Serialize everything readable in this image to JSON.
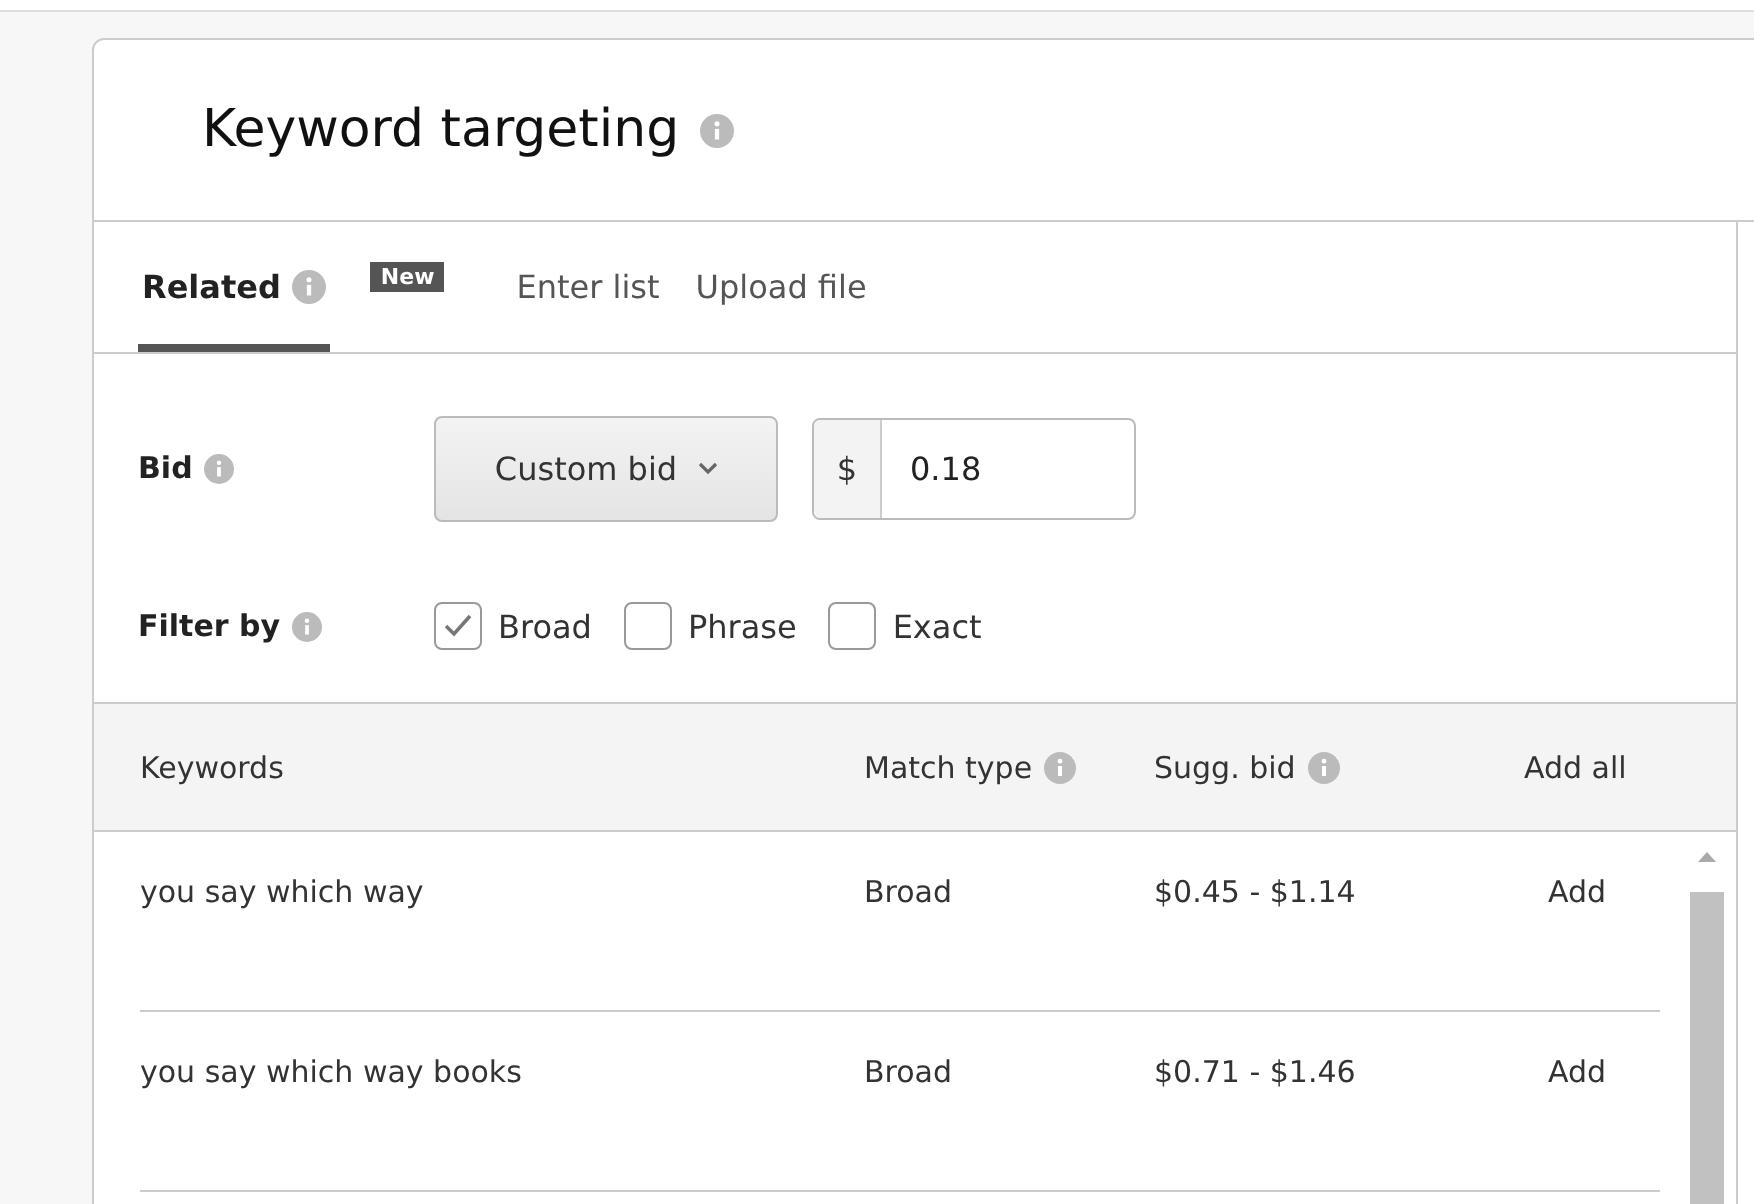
{
  "title": "Keyword targeting",
  "tabs": [
    {
      "label": "Related",
      "selected": true,
      "info": true,
      "badge": "New"
    },
    {
      "label": "Enter list",
      "selected": false
    },
    {
      "label": "Upload file",
      "selected": false
    }
  ],
  "bid": {
    "label": "Bid",
    "dropdown": "Custom bid",
    "currency": "$",
    "value": "0.18"
  },
  "filter": {
    "label": "Filter by",
    "options": [
      {
        "label": "Broad",
        "checked": true
      },
      {
        "label": "Phrase",
        "checked": false
      },
      {
        "label": "Exact",
        "checked": false
      }
    ]
  },
  "table": {
    "columns": [
      {
        "label": "Keywords",
        "info": false
      },
      {
        "label": "Match type",
        "info": true
      },
      {
        "label": "Sugg. bid",
        "info": true
      }
    ],
    "add_all": "Add all",
    "rows": [
      {
        "keyword": "you say which way",
        "match_type": "Broad",
        "sugg_bid": "$0.45 - $1.14",
        "action": "Add"
      },
      {
        "keyword": "you say which way books",
        "match_type": "Broad",
        "sugg_bid": "$0.71 - $1.46",
        "action": "Add"
      }
    ]
  }
}
